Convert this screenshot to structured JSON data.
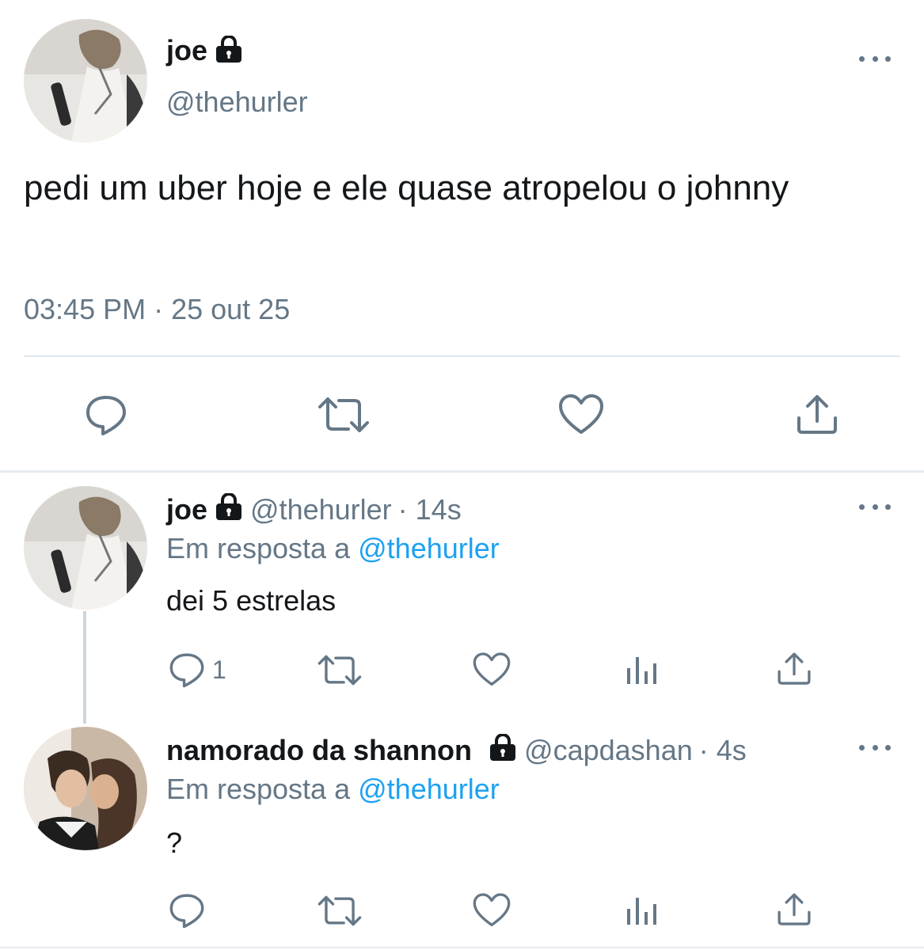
{
  "main_tweet": {
    "display_name": "joe",
    "handle": "@thehurler",
    "text": "pedi um uber hoje e ele quase atropelou o johnny",
    "timestamp": "03:45 PM · 25 out 25",
    "protected": true,
    "avatar_icon": "profile-photo",
    "actions": [
      "reply-icon",
      "retweet-icon",
      "like-icon",
      "share-icon"
    ]
  },
  "replies": [
    {
      "display_name": "joe",
      "handle": "@thehurler",
      "time": "· 14s",
      "reply_prefix": "Em resposta a",
      "reply_to": "@thehurler",
      "text": "dei 5 estrelas",
      "reply_count": "1",
      "protected": true
    },
    {
      "display_name": "namorado da shannon",
      "handle": "@capdashan",
      "time": "· 4s",
      "reply_prefix": "Em resposta a",
      "reply_to": "@thehurler",
      "text": "?",
      "protected": true
    }
  ],
  "colors": {
    "text": "#14171a",
    "muted": "#657786",
    "link": "#1da1f2",
    "divider": "#e6ecf0"
  }
}
